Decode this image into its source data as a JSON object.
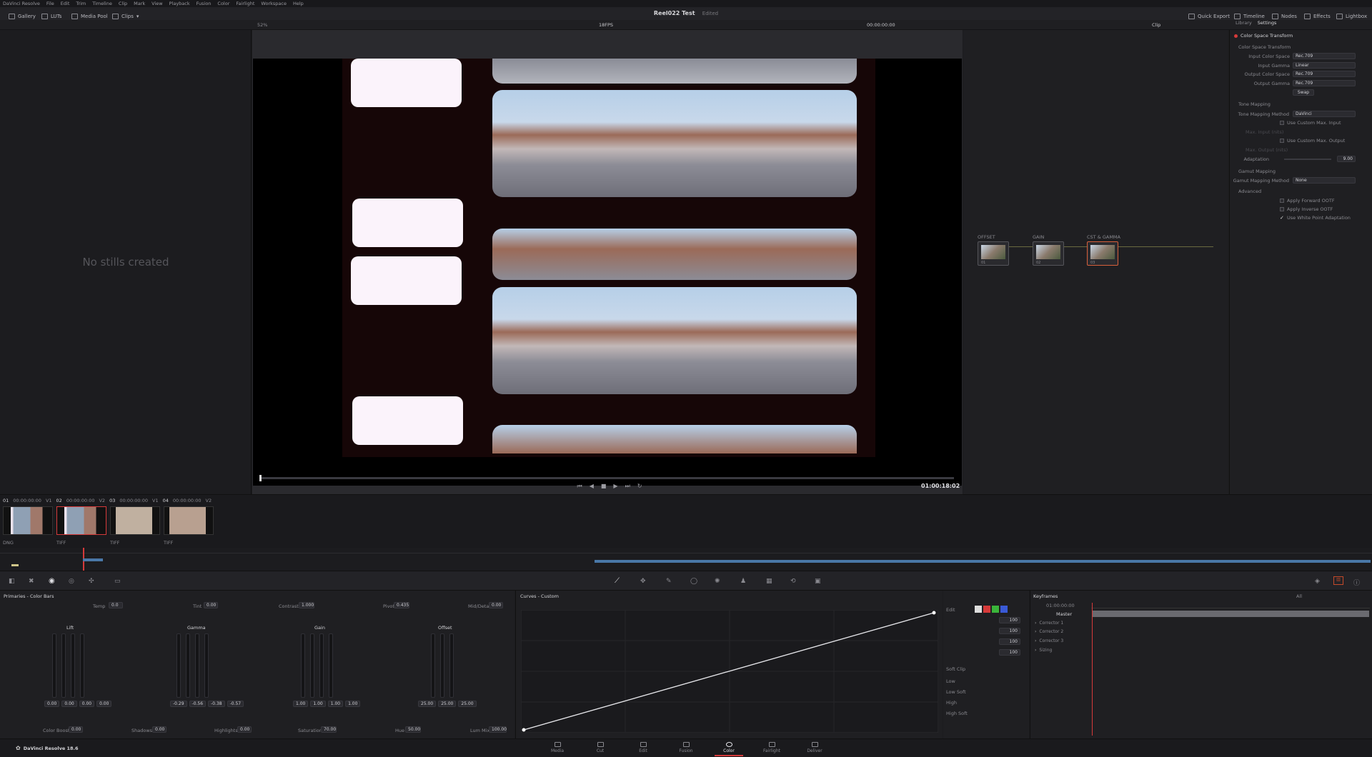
{
  "app": {
    "menu": [
      "DaVinci Resolve",
      "File",
      "Edit",
      "Trim",
      "Timeline",
      "Clip",
      "Mark",
      "View",
      "Playback",
      "Fusion",
      "Color",
      "Fairlight",
      "Workspace",
      "Help"
    ],
    "project_title": "Reel022 Test",
    "project_status": "Edited"
  },
  "toolbar": {
    "left": [
      "Gallery",
      "LUTs",
      "Media Pool",
      "Clips"
    ],
    "right": [
      "Quick Export",
      "Timeline",
      "Nodes",
      "Effects",
      "Lightbox"
    ],
    "zoom": "52%",
    "fps": "18FPS",
    "timecode": "00:00:00:00",
    "clip_mode": "Clip"
  },
  "gallery": {
    "empty_text": "No stills created"
  },
  "viewer": {
    "timecode": "01:00:18:02"
  },
  "nodes": [
    {
      "label": "OFFSET",
      "num": "01"
    },
    {
      "label": "GAIN",
      "num": "02"
    },
    {
      "label": "CST & GAMMA",
      "num": "03"
    }
  ],
  "settings": {
    "tabs": [
      "Library",
      "Settings"
    ],
    "title": "Color Space Transform",
    "section_cst": "Color Space Transform",
    "rows": [
      {
        "label": "Input Color Space",
        "value": "Rec.709"
      },
      {
        "label": "Input Gamma",
        "value": "Linear"
      },
      {
        "label": "Output Color Space",
        "value": "Rec.709"
      },
      {
        "label": "Output Gamma",
        "value": "Rec.709"
      }
    ],
    "swap": "Swap",
    "section_tone": "Tone Mapping",
    "tone_method_label": "Tone Mapping Method",
    "tone_method_value": "DaVinci",
    "use_custom_input": "Use Custom Max. Input",
    "max_input_label": "Max. Input (nits)",
    "use_custom_output": "Use Custom Max. Output",
    "max_output_label": "Max. Output (nits)",
    "adaptation_label": "Adaptation",
    "adaptation_value": "9.00",
    "section_gamut": "Gamut Mapping",
    "gamut_method_label": "Gamut Mapping Method",
    "gamut_method_value": "None",
    "section_advanced": "Advanced",
    "apply_forward": "Apply Forward OOTF",
    "apply_inverse": "Apply Inverse OOTF",
    "white_point": "Use White Point Adaptation"
  },
  "clips": [
    {
      "num": "01",
      "tc": "00:00:00:00",
      "track": "V1",
      "codec": "DNG"
    },
    {
      "num": "02",
      "tc": "00:00:00:00",
      "track": "V2",
      "codec": "TIFF"
    },
    {
      "num": "03",
      "tc": "00:00:00:00",
      "track": "V1",
      "codec": "TIFF"
    },
    {
      "num": "04",
      "tc": "00:00:00:00",
      "track": "V2",
      "codec": "TIFF"
    }
  ],
  "primaries": {
    "title": "Primaries - Color Bars",
    "temp_label": "Temp",
    "temp": "0.0",
    "tint_label": "Tint",
    "tint": "0.00",
    "contrast_label": "Contrast",
    "contrast": "1.000",
    "pivot_label": "Pivot",
    "pivot": "0.435",
    "middetail_label": "Mid/Detail",
    "middetail": "0.00",
    "wheels": [
      {
        "name": "Lift",
        "values": [
          "0.00",
          "0.00",
          "0.00",
          "0.00"
        ]
      },
      {
        "name": "Gamma",
        "values": [
          "-0.29",
          "-0.56",
          "-0.38",
          "-0.57"
        ]
      },
      {
        "name": "Gain",
        "values": [
          "1.00",
          "1.00",
          "1.00",
          "1.00"
        ]
      },
      {
        "name": "Offset",
        "values": [
          "25.00",
          "25.00",
          "25.00"
        ]
      }
    ],
    "colorboost_label": "Color Boost",
    "colorboost": "0.00",
    "shadows_label": "Shadows",
    "shadows": "0.00",
    "highlights_label": "Highlights",
    "highlights": "0.00",
    "saturation_label": "Saturation",
    "saturation": "70.00",
    "hue_label": "Hue",
    "hue": "50.00",
    "lummix_label": "Lum Mix",
    "lummix": "100.00"
  },
  "curves": {
    "title": "Curves - Custom",
    "edit_label": "Edit",
    "intensity": [
      "100",
      "100",
      "100",
      "100"
    ],
    "softclip_label": "Soft Clip",
    "softclip_rows": [
      "Low",
      "Low Soft",
      "High",
      "High Soft"
    ]
  },
  "keyframes": {
    "title": "Keyframes",
    "filter": "All",
    "timecode": "01:00:00:00",
    "rows": [
      "Master",
      "Corrector 1",
      "Corrector 2",
      "Corrector 3",
      "Sizing"
    ]
  },
  "bottom": {
    "app_name": "DaVinci Resolve 18.6",
    "pages": [
      "Media",
      "Cut",
      "Edit",
      "Fusion",
      "Color",
      "Fairlight",
      "Deliver"
    ],
    "active_page": "Color"
  }
}
